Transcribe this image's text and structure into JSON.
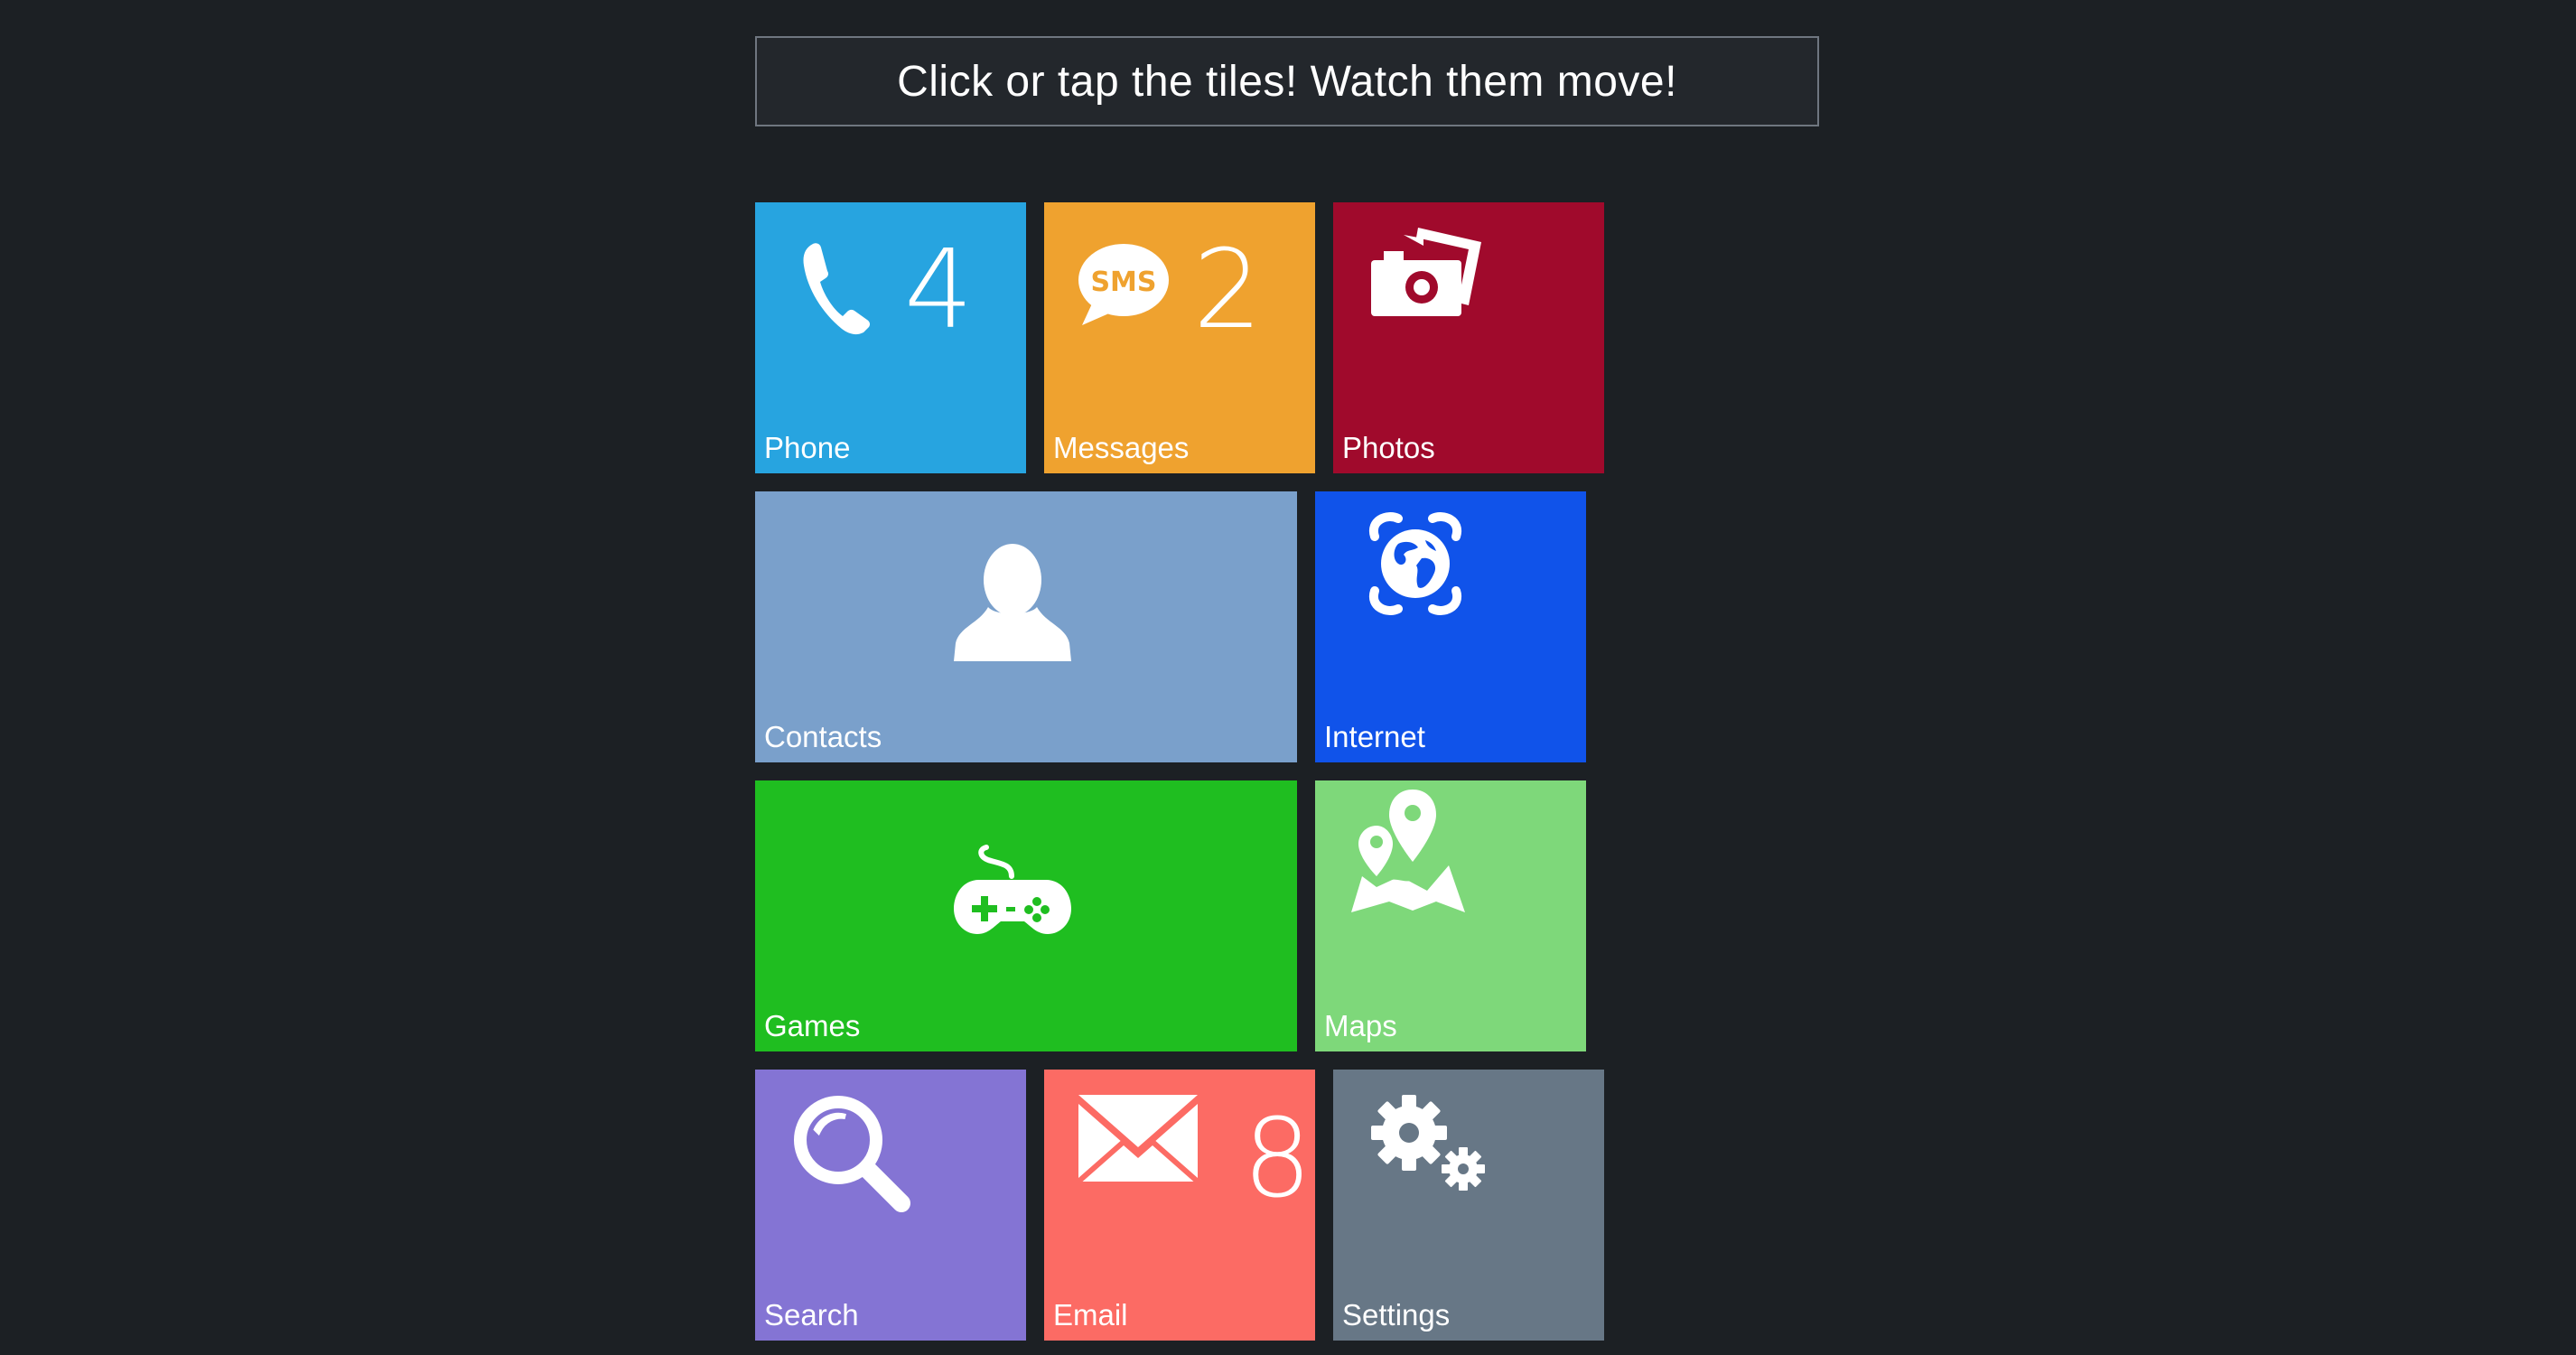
{
  "banner": {
    "text": "Click or tap the tiles! Watch them move!"
  },
  "tiles": {
    "phone": {
      "label": "Phone",
      "count": "4",
      "icon": "phone-icon",
      "color": "#27a4e0"
    },
    "messages": {
      "label": "Messages",
      "count": "2",
      "icon": "sms-icon",
      "color": "#efa22f"
    },
    "photos": {
      "label": "Photos",
      "icon": "camera-icon",
      "color": "#a00a2c"
    },
    "contacts": {
      "label": "Contacts",
      "icon": "person-icon",
      "color": "#7aa0cb"
    },
    "internet": {
      "label": "Internet",
      "icon": "globe-icon",
      "color": "#1053ea"
    },
    "games": {
      "label": "Games",
      "icon": "gamepad-icon",
      "color": "#1fbe20"
    },
    "maps": {
      "label": "Maps",
      "icon": "map-pin-icon",
      "color": "#7ed87a"
    },
    "search": {
      "label": "Search",
      "icon": "search-icon",
      "color": "#8474d4"
    },
    "email": {
      "label": "Email",
      "count": "8",
      "icon": "envelope-icon",
      "color": "#fc6b64"
    },
    "settings": {
      "label": "Settings",
      "icon": "gears-icon",
      "color": "#677786"
    }
  }
}
